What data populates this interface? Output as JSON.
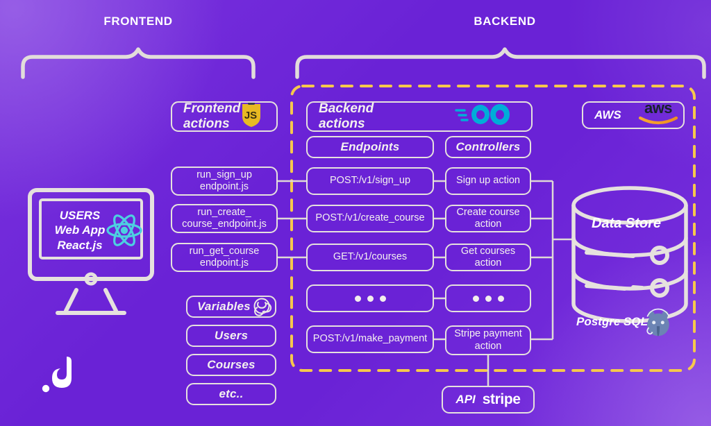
{
  "theme": {
    "background_purple": "#6A22D6",
    "background_purple_light": "#8A52DD",
    "stroke_cream": "#E6E1DE",
    "dashed_border_orange": "#F6C84C",
    "go_cyan": "#00ADD8",
    "react_cyan": "#4DD0E1",
    "js_yellow": "#F0DB4F",
    "aws_orange": "#F0A136",
    "postgres_blue": "#6C84B4"
  },
  "sections": [
    {
      "label": "FRONTEND"
    },
    {
      "label": "BACKEND"
    }
  ],
  "frontend": {
    "monitor": {
      "lines": [
        "USERS",
        "Web App",
        "React.js"
      ],
      "icon": "react-icon"
    },
    "actions_header": {
      "label": "Frontend\nactions",
      "line1": "Frontend",
      "line2": "actions",
      "icon": "javascript-icon"
    },
    "endpoint_files": [
      {
        "line1": "run_sign_up",
        "line2": "endpoint.js"
      },
      {
        "line1": "run_create_",
        "line2": "course_endpoint.js"
      },
      {
        "line1": "run_get_course",
        "line2": "endpoint.js"
      }
    ],
    "variables": {
      "header": {
        "label": "Variables",
        "icon": "redux-icon"
      },
      "items": [
        "Users",
        "Courses",
        "etc.."
      ]
    },
    "logo": "dot-d-logo"
  },
  "backend": {
    "actions_header": {
      "line1": "Backend",
      "line2": "actions",
      "icon": "go-icon"
    },
    "cloud": {
      "label": "AWS",
      "icon": "aws-icon"
    },
    "columns": [
      {
        "header": "Endpoints"
      },
      {
        "header": "Controllers"
      }
    ],
    "rows": [
      {
        "endpoint": "POST:/v1/sign_up",
        "controller_line1": "Sign up action",
        "controller_line2": ""
      },
      {
        "endpoint": "POST:/v1/create_course",
        "controller_line1": "Create course",
        "controller_line2": "action"
      },
      {
        "endpoint": "GET:/v1/courses",
        "controller_line1": "Get courses",
        "controller_line2": "action"
      },
      {
        "endpoint": "",
        "controller_line1": "",
        "controller_line2": "",
        "ellipsis": true
      },
      {
        "endpoint": "POST:/v1/make_payment",
        "controller_line1": "Stripe payment",
        "controller_line2": "action"
      }
    ],
    "datastore": {
      "label": "Data Store",
      "caption": "Postgre SQL",
      "icon": "postgresql-icon"
    },
    "api": {
      "label": "API",
      "service": "stripe",
      "icon": "stripe-icon"
    }
  }
}
